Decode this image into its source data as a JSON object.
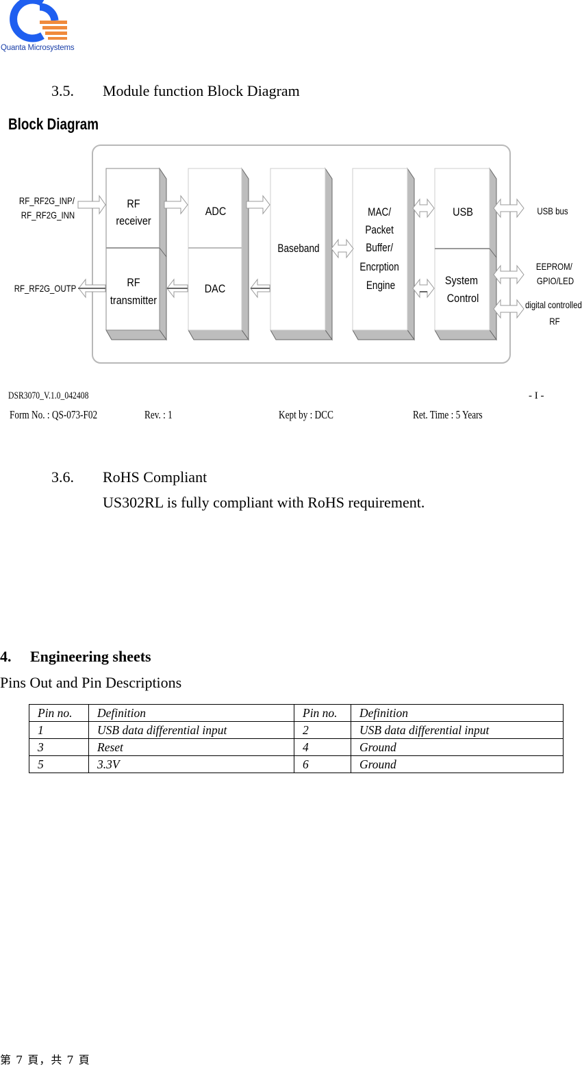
{
  "header": {
    "logo_icon": "quanta-logo-icon",
    "logo_text": "Quanta Microsystems",
    "brand_colors": {
      "ring": "#1f5ff0",
      "stripes": "#f08a3c",
      "text": "#1a3fa8"
    }
  },
  "section_3_5": {
    "number": "3.5.",
    "title": "Module function Block Diagram"
  },
  "diagram": {
    "title": "Block Diagram",
    "blocks": {
      "rf_receiver": "RF\nreceiver",
      "rf_transmitter": "RF\ntransmitter",
      "adc": "ADC",
      "dac": "DAC",
      "baseband": "Baseband",
      "mac": [
        "MAC/",
        "Packet",
        "Buffer/",
        "Encrption",
        "Engine"
      ],
      "usb": "USB",
      "system_control": [
        "System",
        "Control"
      ]
    },
    "external_labels": {
      "rf_in": [
        "RF_RF2G_INP/",
        "RF_RF2G_INN"
      ],
      "rf_out": "RF_RF2G_OUTP",
      "usb_bus": "USB bus",
      "eeprom": [
        "EEPROM/",
        "GPIO/LED"
      ],
      "digital_rf": [
        "digital controlled",
        "RF"
      ]
    },
    "rf_receiver_lines": [
      "RF",
      "receiver"
    ],
    "rf_transmitter_lines": [
      "RF",
      "transmitter"
    ],
    "footer": {
      "doc_id": "DSR3070_V.1.0_042408",
      "page_marker": "- I -",
      "form_no": "Form No. : QS-073-F02",
      "rev": "Rev. : 1",
      "kept_by": "Kept by :   DCC",
      "ret_time": "Ret. Time :    5 Years"
    }
  },
  "section_3_6": {
    "number": "3.6.",
    "title": "RoHS Compliant",
    "body": "US302RL is fully compliant with RoHS requirement."
  },
  "section_4": {
    "number": "4.",
    "title": "Engineering sheets",
    "subtitle": "Pins Out and Pin Descriptions",
    "table": {
      "headers": [
        "Pin no.",
        "Definition",
        "Pin no.",
        "Definition"
      ],
      "rows": [
        [
          "1",
          "USB data differential input",
          "2",
          "USB data differential input"
        ],
        [
          "3",
          "Reset",
          "4",
          "Ground"
        ],
        [
          "5",
          "3.3V",
          "6",
          "Ground"
        ]
      ]
    }
  },
  "page_footer": "第 7 頁，共 7 頁"
}
